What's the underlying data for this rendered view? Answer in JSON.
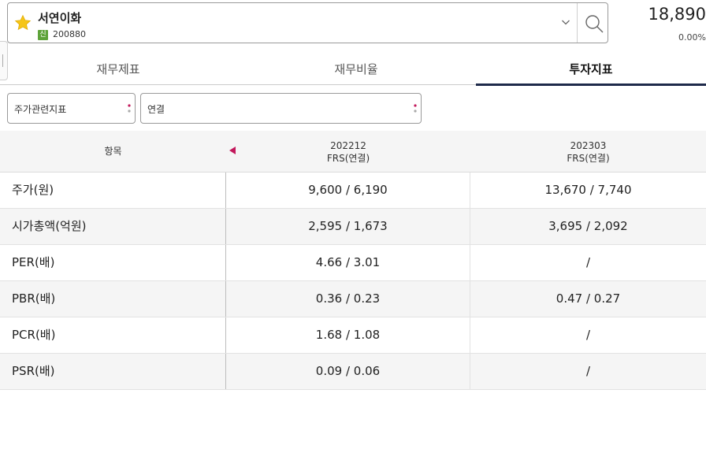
{
  "stock": {
    "name": "서연이화",
    "badge": "신",
    "code": "200880",
    "price": "18,890",
    "change": "0.00%"
  },
  "tabs": [
    {
      "label": "재무제표",
      "active": false
    },
    {
      "label": "재무비율",
      "active": false
    },
    {
      "label": "투자지표",
      "active": true
    }
  ],
  "filters": {
    "indicator": "주가관련지표",
    "basis": "연결"
  },
  "table": {
    "headers": {
      "item": "항목",
      "col1_period": "202212",
      "col1_basis": "FRS(연결)",
      "col2_period": "202303",
      "col2_basis": "FRS(연결)"
    },
    "rows": [
      {
        "label": "주가(원)",
        "v1": "9,600 / 6,190",
        "v2": "13,670 / 7,740"
      },
      {
        "label": "시가총액(억원)",
        "v1": "2,595 / 1,673",
        "v2": "3,695 / 2,092"
      },
      {
        "label": "PER(배)",
        "v1": "4.66 / 3.01",
        "v2": "/"
      },
      {
        "label": "PBR(배)",
        "v1": "0.36 / 0.23",
        "v2": "0.47 / 0.27"
      },
      {
        "label": "PCR(배)",
        "v1": "1.68 / 1.08",
        "v2": "/"
      },
      {
        "label": "PSR(배)",
        "v1": "0.09 / 0.06",
        "v2": "/"
      }
    ]
  },
  "colors": {
    "star": "#f5c518",
    "badge": "#5ea33a",
    "active_tab_underline": "#1e2a4a",
    "accent_arrow": "#c2185b"
  },
  "icons": {
    "favorite": "star-icon",
    "dropdown": "chevron-down-icon",
    "search": "search-icon",
    "sort": "triangle-left-icon"
  }
}
